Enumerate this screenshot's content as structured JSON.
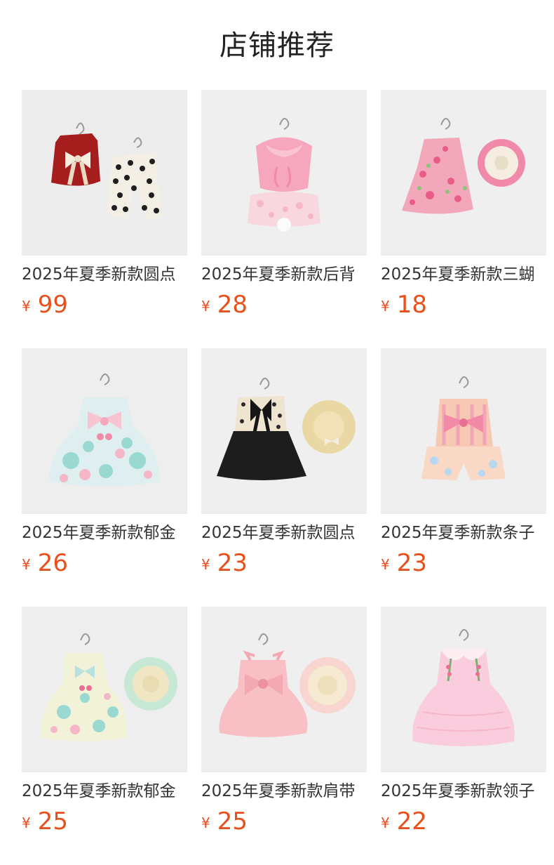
{
  "section_title": "店铺推荐",
  "currency_symbol": "¥",
  "accent_color": "#e8501c",
  "products": [
    {
      "name": "2025年夏季新款圆点",
      "price": "99",
      "image": "red-vest-polka-dot-pants-set"
    },
    {
      "name": "2025年夏季新款后背",
      "price": "28",
      "image": "pink-bunny-top-floral-shorts-set"
    },
    {
      "name": "2025年夏季新款三蝴",
      "price": "18",
      "image": "pink-floral-dress-with-hat"
    },
    {
      "name": "2025年夏季新款郁金",
      "price": "26",
      "image": "tulip-print-bow-dress"
    },
    {
      "name": "2025年夏季新款圆点",
      "price": "23",
      "image": "black-dress-polka-dot-with-straw-hat"
    },
    {
      "name": "2025年夏季新款条子",
      "price": "23",
      "image": "striped-bow-top-shorts-set"
    },
    {
      "name": "2025年夏季新款郁金",
      "price": "25",
      "image": "tulip-print-dress-with-hat"
    },
    {
      "name": "2025年夏季新款肩带",
      "price": "25",
      "image": "pink-tutu-dress-with-hat"
    },
    {
      "name": "2025年夏季新款领子",
      "price": "22",
      "image": "pink-lace-collar-dress"
    }
  ]
}
